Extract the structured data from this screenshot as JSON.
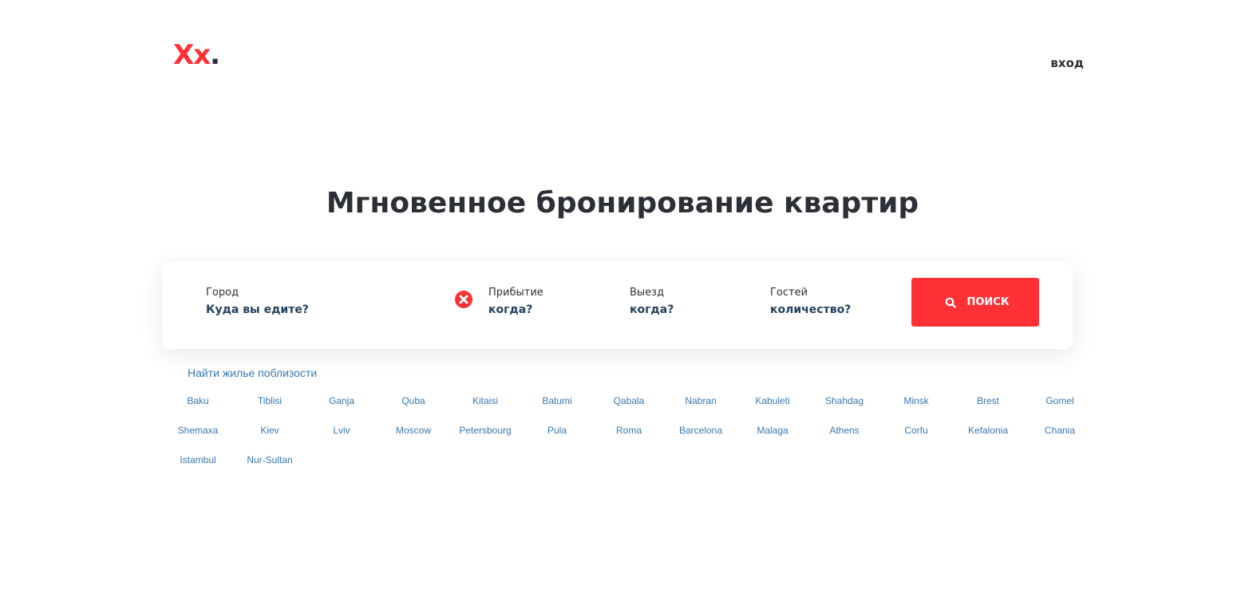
{
  "header": {
    "logo_letters": "Xx",
    "logo_dot": ".",
    "login_label": "вход"
  },
  "hero": {
    "title": "Мгновенное бронирование квартир"
  },
  "search": {
    "city_label": "Город",
    "city_placeholder": "Куда вы едите?",
    "arrival_label": "Прибытие",
    "arrival_placeholder": "когда?",
    "departure_label": "Выезд",
    "departure_placeholder": "когда?",
    "guests_label": "Гостей",
    "guests_placeholder": "количество?",
    "button_label": "ПОИСК"
  },
  "nearby": {
    "label": "Найти жилье поблизости"
  },
  "cities": [
    "Baku",
    "Tiblisi",
    "Ganja",
    "Quba",
    "Kitaisi",
    "Batumi",
    "Qabala",
    "Nabran",
    "Kabuleti",
    "Shahdag",
    "Minsk",
    "Brest",
    "Gomel",
    "Shemaxa",
    "Kiev",
    "Lviv",
    "Moscow",
    "Petersbourg",
    "Pula",
    "Roma",
    "Barcelona",
    "Malaga",
    "Athens",
    "Corfu",
    "Kefalonia",
    "Chania",
    "Istambul",
    "Nur-Sultan"
  ],
  "colors": {
    "accent": "#ff3136",
    "text_dark": "#2c3036",
    "field_value": "#24425f",
    "link": "#3978b1"
  }
}
